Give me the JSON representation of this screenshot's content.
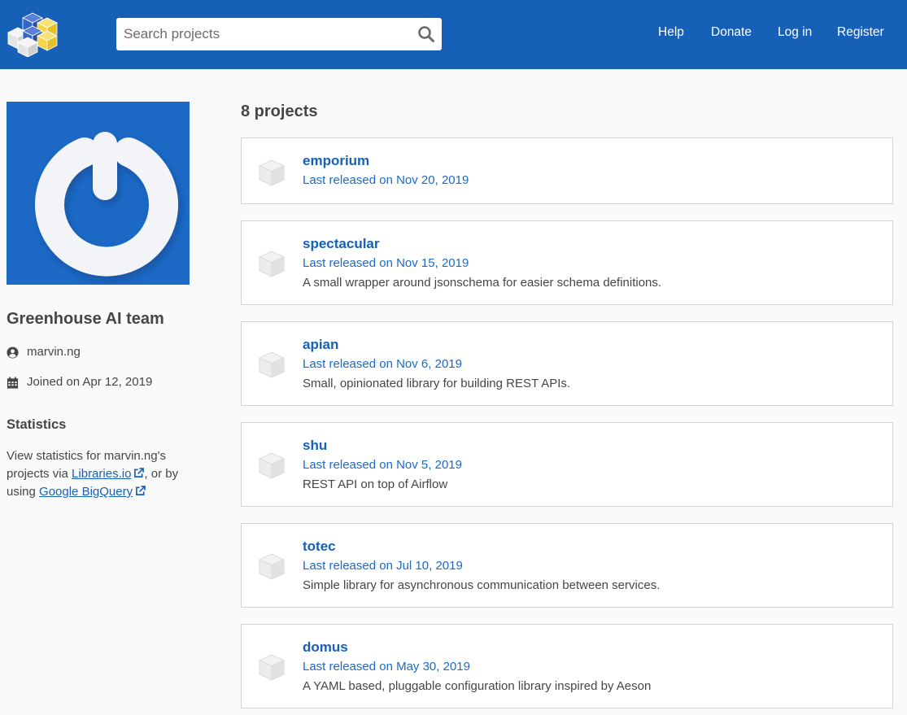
{
  "header": {
    "search_placeholder": "Search projects",
    "nav": [
      "Help",
      "Donate",
      "Log in",
      "Register"
    ]
  },
  "colors": {
    "header_bg": "#1760b8",
    "link": "#1760b8",
    "avatar_bg": "#1c6ac6"
  },
  "profile": {
    "name": "Greenhouse AI team",
    "username": "marvin.ng",
    "joined": "Joined on Apr 12, 2019"
  },
  "statistics": {
    "heading": "Statistics",
    "text_before": "View statistics for marvin.ng's projects via ",
    "link1": "Libraries.io",
    "text_middle": ", or by using ",
    "link2": "Google BigQuery"
  },
  "projects_count": "8 projects",
  "projects": [
    {
      "name": "emporium",
      "released": "Last released on Nov 20, 2019",
      "description": ""
    },
    {
      "name": "spectacular",
      "released": "Last released on Nov 15, 2019",
      "description": "A small wrapper around jsonschema for easier schema definitions."
    },
    {
      "name": "apian",
      "released": "Last released on Nov 6, 2019",
      "description": "Small, opinionated library for building REST APIs."
    },
    {
      "name": "shu",
      "released": "Last released on Nov 5, 2019",
      "description": "REST API on top of Airflow"
    },
    {
      "name": "totec",
      "released": "Last released on Jul 10, 2019",
      "description": "Simple library for asynchronous communication between services."
    },
    {
      "name": "domus",
      "released": "Last released on May 30, 2019",
      "description": "A YAML based, pluggable configuration library inspired by Aeson"
    }
  ],
  "icons": [
    "pypi-logo-icon",
    "search-icon",
    "user-circle-icon",
    "calendar-icon",
    "external-link-icon",
    "package-box-icon"
  ]
}
